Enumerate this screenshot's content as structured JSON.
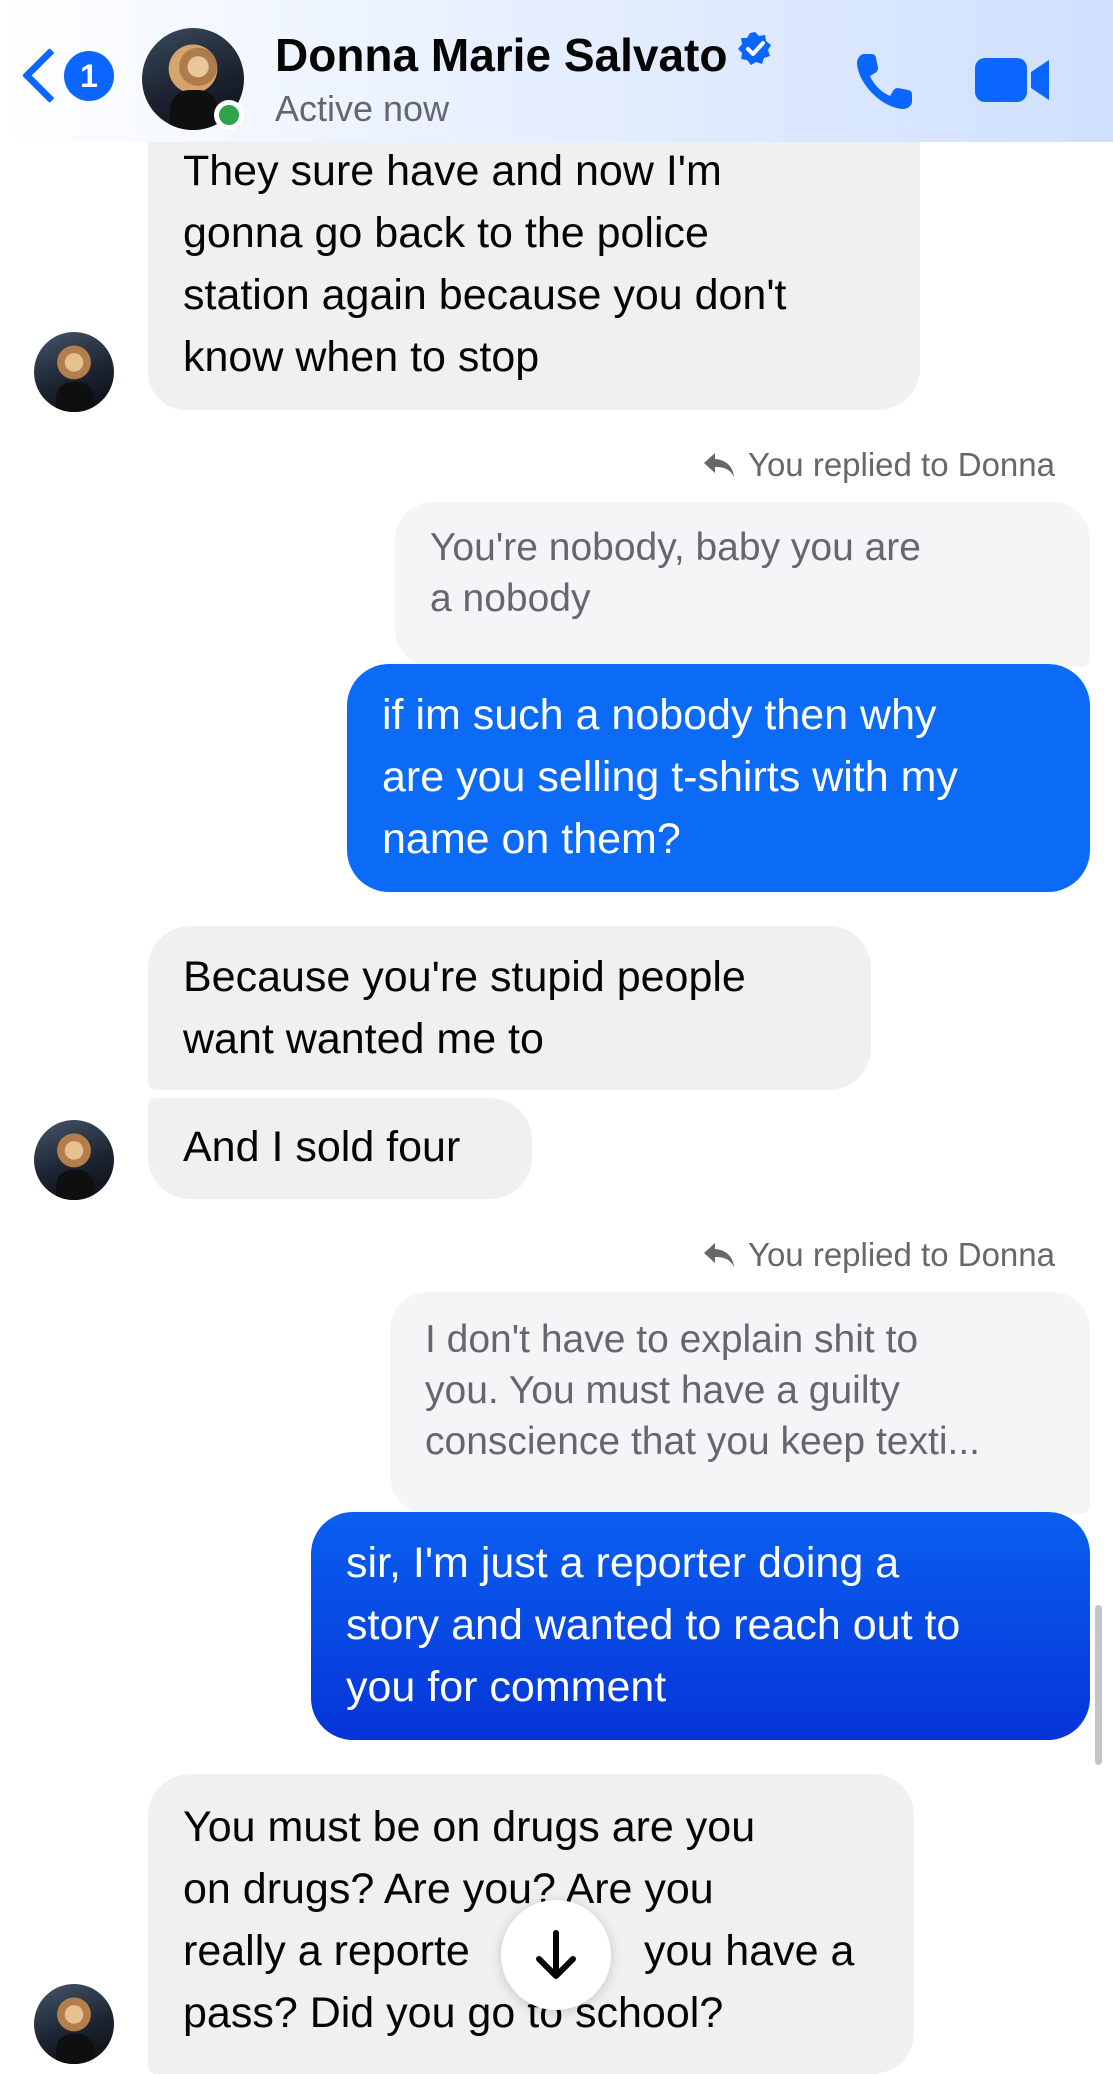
{
  "header": {
    "back_count": "1",
    "contact_name": "Donna Marie Salvato",
    "status": "Active now"
  },
  "messages": [
    {
      "lines": [
        "They sure have and now I'm",
        "gonna go back to the police",
        "station again because you don't",
        "know when to stop"
      ]
    },
    {
      "reply_label": "You replied to Donna",
      "quoted_lines": [
        "You're nobody, baby you are",
        "a nobody"
      ],
      "lines": [
        "if im such a nobody then why",
        "are you selling t-shirts with my",
        "name on them?"
      ]
    },
    {
      "lines": [
        "Because you're stupid people",
        "want wanted me to"
      ]
    },
    {
      "lines": [
        "And I sold four"
      ]
    },
    {
      "reply_label": "You replied to Donna",
      "quoted_lines": [
        "I don't have to explain shit to",
        "you. You must have a guilty",
        "conscience that you keep texti..."
      ],
      "lines": [
        "sir, I'm just a reporter doing a",
        "story and wanted to reach out to",
        "you for comment"
      ]
    },
    {
      "lines": [
        "You must be on drugs are you",
        "on drugs? Are you? Are you",
        "really a reporte",
        "pass? Did you go to school?"
      ],
      "line3_tail": "you have a"
    }
  ],
  "icons": {
    "back": "chevron-left-icon",
    "verified": "verified-badge-icon",
    "call": "phone-icon",
    "video": "video-camera-icon",
    "reply": "reply-arrow-icon",
    "scroll_down": "arrow-down-icon"
  },
  "colors": {
    "accent": "#0a66ff",
    "outgoing_bubble": "#0a6cf5",
    "incoming_bubble": "#f0f0f3",
    "online": "#31a24c"
  }
}
